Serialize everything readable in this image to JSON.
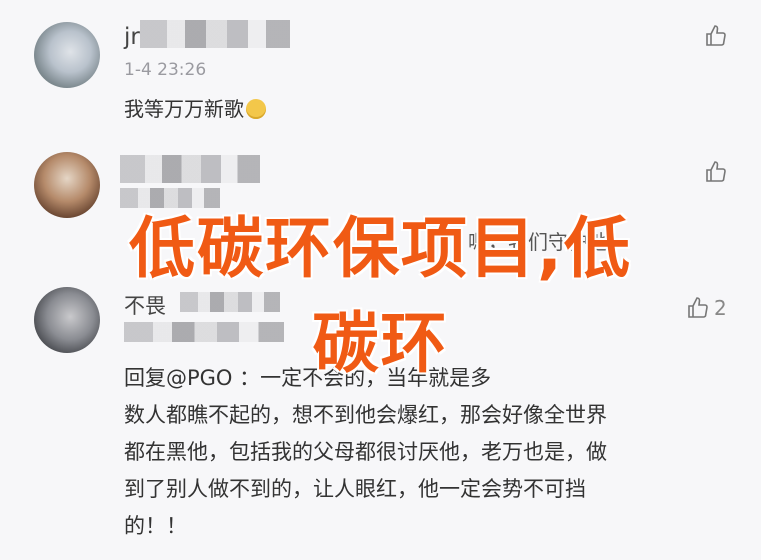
{
  "comments": [
    {
      "name": "jr",
      "time": "1-4 23:26",
      "text": "我等万万新歌",
      "likes": ""
    },
    {
      "name": "",
      "time": "",
      "text": "嗯，我们守护他",
      "likes": ""
    },
    {
      "name": "不畏",
      "time": "",
      "likes": "2",
      "reply_lines": [
        "回复@PGO ：一定不会的，当年就是多",
        "数人都瞧不起的，想不到他会爆红，那会好像全世界",
        "都在黑他，包括我的父母都很讨厌他，老万也是，做",
        "到了别人做不到的，让人眼红，他一定会势不可挡",
        "的！！"
      ]
    }
  ],
  "overlay": {
    "line1": "低碳环保项目,低",
    "line2": "碳环"
  },
  "colors": {
    "overlay_text": "#f05a14",
    "background": "#f7f7f9"
  },
  "icons": {
    "like": "thumbs-up-icon",
    "emoji": "smile-emoji-icon"
  }
}
